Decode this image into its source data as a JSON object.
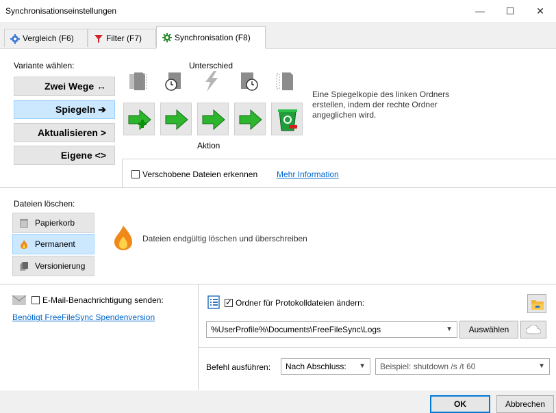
{
  "window": {
    "title": "Synchronisationseinstellungen",
    "minimize": "—",
    "maximize": "☐",
    "close": "✕"
  },
  "tabs": [
    {
      "label": "Vergleich (F6)",
      "icon": "gear-blue-icon"
    },
    {
      "label": "Filter (F7)",
      "icon": "funnel-icon"
    },
    {
      "label": "Synchronisation (F8)",
      "icon": "gear-green-icon",
      "active": true
    }
  ],
  "variant": {
    "heading": "Variante wählen:",
    "options": [
      {
        "label": "Zwei Wege ↔",
        "selected": false
      },
      {
        "label": "Spiegeln ➔",
        "selected": true
      },
      {
        "label": "Aktualisieren >",
        "selected": false
      },
      {
        "label": "Eigene <>",
        "selected": false
      }
    ]
  },
  "difference_label": "Unterschied",
  "action_label": "Aktion",
  "description": "Eine Spiegelkopie des linken Ordners erstellen, indem der rechte Ordner angeglichen wird.",
  "detect_moved": {
    "label": "Verschobene Dateien erkennen",
    "checked": false,
    "link": "Mehr Information"
  },
  "delete": {
    "heading": "Dateien löschen:",
    "options": [
      {
        "label": "Papierkorb",
        "selected": false
      },
      {
        "label": "Permanent",
        "selected": true
      },
      {
        "label": "Versionierung",
        "selected": false
      }
    ],
    "description": "Dateien endgültig löschen und überschreiben"
  },
  "email": {
    "label": "E-Mail-Benachrichtigung senden:",
    "checked": false,
    "link": "Benötigt FreeFileSync Spendenversion"
  },
  "logfolder": {
    "label": "Ordner für Protokolldateien ändern:",
    "checked": true,
    "path": "%UserProfile%\\Documents\\FreeFileSync\\Logs",
    "select_button": "Auswählen"
  },
  "command": {
    "label": "Befehl ausführen:",
    "when": "Nach Abschluss:",
    "placeholder": "Beispiel: shutdown /s /t 60"
  },
  "footer": {
    "ok": "OK",
    "cancel": "Abbrechen"
  },
  "colors": {
    "accent_selected": "#cce8ff",
    "link": "#0066cc",
    "arrow_green": "#2db52d"
  }
}
